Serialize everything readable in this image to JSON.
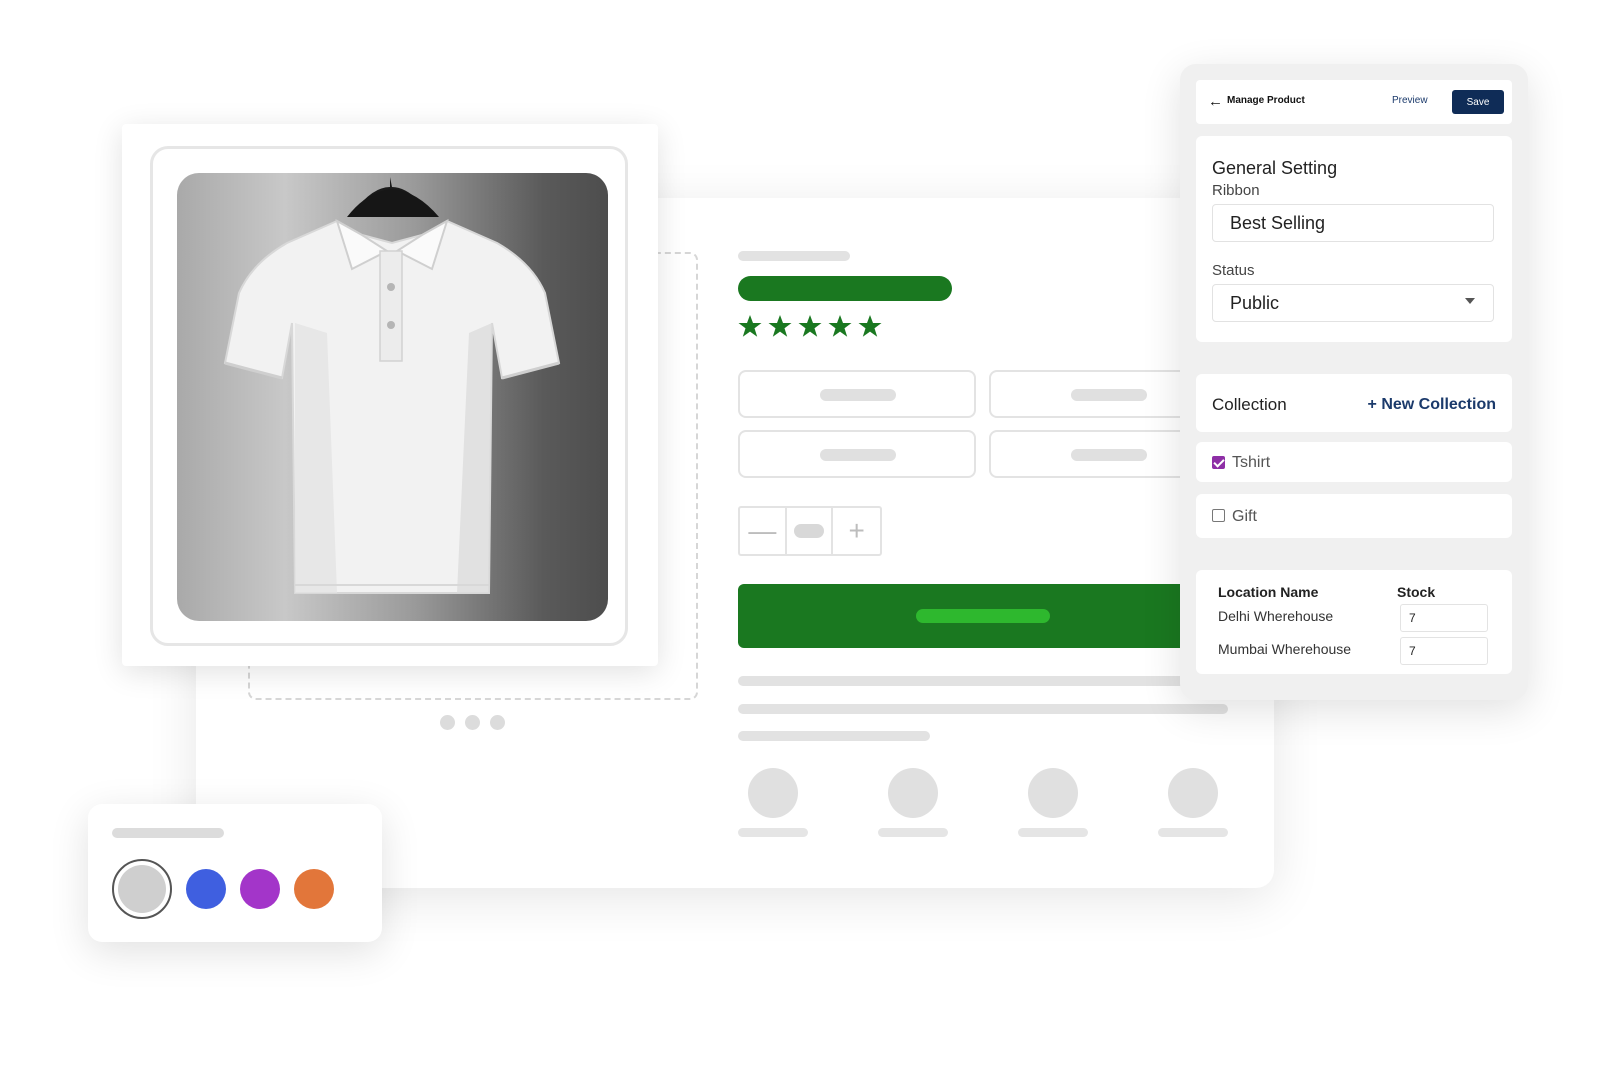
{
  "colors": {
    "accent_green": "#1a7820",
    "navy": "#0f2c57",
    "checkbox_purple": "#8e2fa6",
    "swatches": [
      "#cfcfcf",
      "#3f5fe0",
      "#a335c9",
      "#e2763a"
    ]
  },
  "rating": {
    "stars": 5,
    "max": 5
  },
  "panel": {
    "header": {
      "back_icon": "arrow-left-icon",
      "title": "Manage Product",
      "preview_label": "Preview",
      "save_label": "Save"
    },
    "general": {
      "title": "General Setting",
      "ribbon_label": "Ribbon",
      "ribbon_value": "Best Selling",
      "status_label": "Status",
      "status_value": "Public"
    },
    "collection": {
      "title": "Collection",
      "new_label": "+ New Collection",
      "items": [
        {
          "label": "Tshirt",
          "checked": true
        },
        {
          "label": "Gift",
          "checked": false
        }
      ]
    },
    "stock": {
      "col_location": "Location Name",
      "col_stock": "Stock",
      "rows": [
        {
          "location": "Delhi Wherehouse",
          "stock": "7"
        },
        {
          "location": "Mumbai Wherehouse",
          "stock": "7"
        }
      ]
    }
  }
}
